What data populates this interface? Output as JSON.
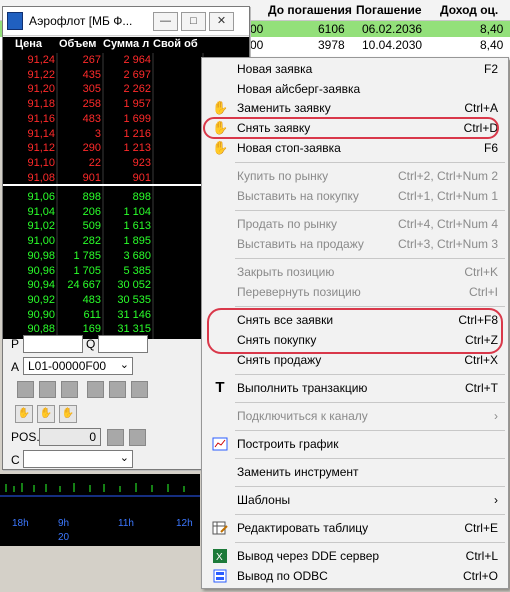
{
  "bonds_table": {
    "headers": [
      "До погашения",
      "Погашение",
      "Доход оц."
    ],
    "rows": [
      {
        "pre": "00",
        "days": "6106",
        "maturity": "06.02.2036",
        "yield": "8,40",
        "highlight": true
      },
      {
        "pre": "00",
        "days": "3978",
        "maturity": "10.04.2030",
        "yield": "8,40",
        "highlight": false
      }
    ]
  },
  "quote_window": {
    "title": "Аэрофлот [МБ Ф...",
    "columns": [
      "Цена",
      "Объем",
      "Сумма л",
      "Свой об"
    ],
    "sell_rows": [
      [
        "91,24",
        "267",
        "2 964"
      ],
      [
        "91,22",
        "435",
        "2 697"
      ],
      [
        "91,20",
        "305",
        "2 262"
      ],
      [
        "91,18",
        "258",
        "1 957"
      ],
      [
        "91,16",
        "483",
        "1 699"
      ],
      [
        "91,14",
        "3",
        "1 216"
      ],
      [
        "91,12",
        "290",
        "1 213"
      ],
      [
        "91,10",
        "22",
        "923"
      ],
      [
        "91,08",
        "901",
        "901"
      ]
    ],
    "buy_rows": [
      [
        "91,06",
        "898",
        "898"
      ],
      [
        "91,04",
        "206",
        "1 104"
      ],
      [
        "91,02",
        "509",
        "1 613"
      ],
      [
        "91,00",
        "282",
        "1 895"
      ],
      [
        "90,98",
        "1 785",
        "3 680"
      ],
      [
        "90,96",
        "1 705",
        "5 385"
      ],
      [
        "90,94",
        "24 667",
        "30 052"
      ],
      [
        "90,92",
        "483",
        "30 535"
      ],
      [
        "90,90",
        "611",
        "31 146"
      ],
      [
        "90,88",
        "169",
        "31 315"
      ]
    ],
    "p_label": "P",
    "q_label": "Q",
    "a_label": "A",
    "account": "L01-00000F00",
    "pos_label": "POS.",
    "pos_value": "0",
    "c_label": "C"
  },
  "bottom_strip": {
    "time_ticks": [
      "18h",
      "9h",
      "11h",
      "12h"
    ],
    "bottom_tick": "20"
  },
  "context_menu": {
    "items": [
      {
        "label": "Новая заявка",
        "shortcut": "F2",
        "icon": "none",
        "disabled": false
      },
      {
        "label": "Новая айсберг-заявка",
        "shortcut": "",
        "icon": "none",
        "disabled": false
      },
      {
        "label": "Заменить заявку",
        "shortcut": "Ctrl+A",
        "icon": "hand-replace-icon",
        "disabled": false
      },
      {
        "label": "Снять заявку",
        "shortcut": "Ctrl+D",
        "icon": "hand-cancel-icon",
        "disabled": false
      },
      {
        "label": "Новая стоп-заявка",
        "shortcut": "F6",
        "icon": "hand-stop-icon",
        "disabled": false
      },
      {
        "label": "Купить по рынку",
        "shortcut": "Ctrl+2, Ctrl+Num 2",
        "icon": "none",
        "disabled": true
      },
      {
        "label": "Выставить на покупку",
        "shortcut": "Ctrl+1, Ctrl+Num 1",
        "icon": "none",
        "disabled": true
      },
      {
        "label": "Продать по рынку",
        "shortcut": "Ctrl+4, Ctrl+Num 4",
        "icon": "none",
        "disabled": true
      },
      {
        "label": "Выставить на продажу",
        "shortcut": "Ctrl+3, Ctrl+Num 3",
        "icon": "none",
        "disabled": true
      },
      {
        "label": "Закрыть позицию",
        "shortcut": "Ctrl+K",
        "icon": "none",
        "disabled": true
      },
      {
        "label": "Перевернуть позицию",
        "shortcut": "Ctrl+I",
        "icon": "none",
        "disabled": true
      },
      {
        "label": "Снять все заявки",
        "shortcut": "Ctrl+F8",
        "icon": "none",
        "disabled": false
      },
      {
        "label": "Снять покупку",
        "shortcut": "Ctrl+Z",
        "icon": "none",
        "disabled": false
      },
      {
        "label": "Снять продажу",
        "shortcut": "Ctrl+X",
        "icon": "none",
        "disabled": false
      },
      {
        "label": "Выполнить транзакцию",
        "shortcut": "Ctrl+T",
        "icon": "transaction-icon",
        "disabled": false
      },
      {
        "label": "Подключиться к каналу",
        "shortcut": "›",
        "icon": "none",
        "disabled": true
      },
      {
        "label": "Построить график",
        "shortcut": "",
        "icon": "chart-icon",
        "disabled": false
      },
      {
        "label": "Заменить инструмент",
        "shortcut": "",
        "icon": "none",
        "disabled": false
      },
      {
        "label": "Шаблоны",
        "shortcut": "›",
        "icon": "none",
        "disabled": false
      },
      {
        "label": "Редактировать таблицу",
        "shortcut": "Ctrl+E",
        "icon": "edit-table-icon",
        "disabled": false
      },
      {
        "label": "Вывод через DDE сервер",
        "shortcut": "Ctrl+L",
        "icon": "excel-icon",
        "disabled": false
      },
      {
        "label": "Вывод по ODBC",
        "shortcut": "Ctrl+O",
        "icon": "odbc-icon",
        "disabled": false
      }
    ]
  },
  "colors": {
    "sell_text": "#ff2a2a",
    "buy_text": "#2aff2a",
    "highlight_row": "#93e07a",
    "annotation_ring": "#d9384a",
    "chart_tick": "#3c78ff"
  }
}
